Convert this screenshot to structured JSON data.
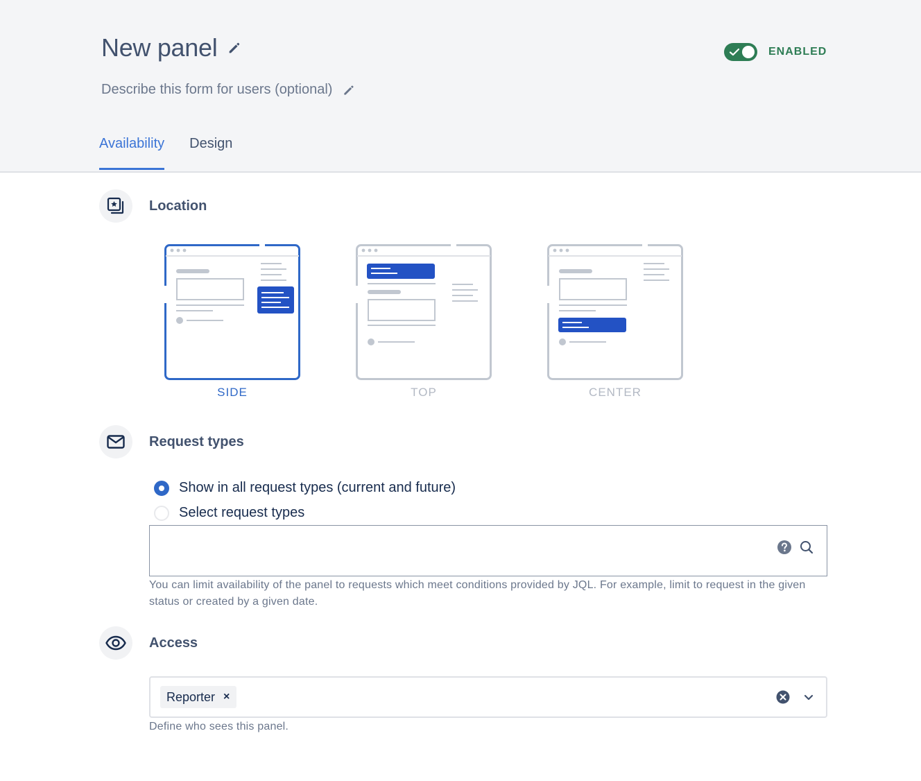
{
  "header": {
    "title": "New panel",
    "description_placeholder": "Describe this form for users (optional)",
    "status_label": "ENABLED",
    "enabled": true
  },
  "tabs": [
    {
      "label": "Availability",
      "active": true
    },
    {
      "label": "Design",
      "active": false
    }
  ],
  "location": {
    "title": "Location",
    "options": [
      {
        "label": "SIDE",
        "selected": true
      },
      {
        "label": "TOP",
        "selected": false
      },
      {
        "label": "CENTER",
        "selected": false
      }
    ]
  },
  "request_types": {
    "title": "Request types",
    "options": [
      {
        "label": "Show in all request types (current and future)",
        "checked": true
      },
      {
        "label": "Select request types",
        "checked": false
      }
    ],
    "jql_value": "",
    "help": "You can limit availability of the panel to requests which meet conditions provided by JQL. For example, limit to request in the given status or created by a given date."
  },
  "access": {
    "title": "Access",
    "tags": [
      "Reporter"
    ],
    "help": "Define who sees this panel."
  },
  "colors": {
    "accent": "#3b74d6",
    "enabled_green": "#2e7d55",
    "preview_blue": "#2352c4"
  },
  "icons": [
    "pencil-icon",
    "check-icon",
    "location-icon",
    "mail-icon",
    "help-icon",
    "search-icon",
    "eye-icon",
    "clear-icon",
    "chevron-down-icon",
    "remove-tag-icon"
  ]
}
